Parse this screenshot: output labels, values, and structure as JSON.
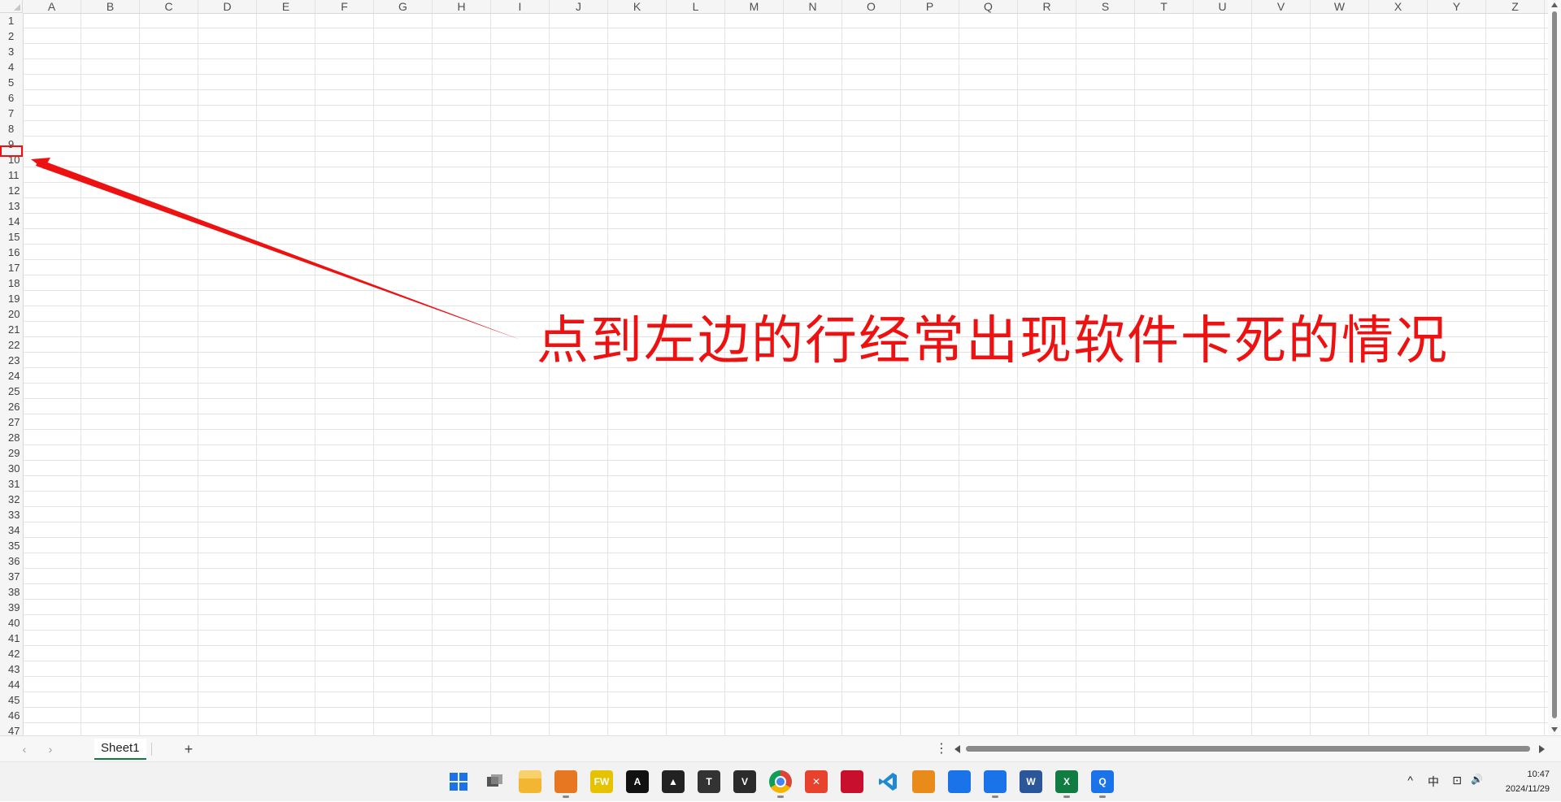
{
  "spreadsheet": {
    "columns": [
      "A",
      "B",
      "C",
      "D",
      "E",
      "F",
      "G",
      "H",
      "I",
      "J",
      "K",
      "L",
      "M",
      "N",
      "O",
      "P",
      "Q",
      "R",
      "S",
      "T",
      "U",
      "V",
      "W",
      "X",
      "Y",
      "Z"
    ],
    "rows": [
      "1",
      "2",
      "3",
      "4",
      "5",
      "6",
      "7",
      "8",
      "9",
      "10",
      "11",
      "12",
      "13",
      "14",
      "15",
      "16",
      "17",
      "18",
      "19",
      "20",
      "21",
      "22",
      "23",
      "24",
      "25",
      "26",
      "27",
      "28",
      "29",
      "30",
      "31",
      "32",
      "33",
      "34",
      "35",
      "36",
      "37",
      "38",
      "39",
      "40",
      "41",
      "42",
      "43",
      "44",
      "45",
      "46",
      "47"
    ],
    "highlighted_row": "10"
  },
  "annotation": {
    "text": "点到左边的行经常出现软件卡死的情况",
    "color": "#ee1111"
  },
  "sheet_bar": {
    "prev_label": "‹",
    "next_label": "›",
    "active_sheet": "Sheet1",
    "add_label": "+",
    "more_label": "⋮"
  },
  "taskbar": {
    "icons": [
      {
        "name": "windows-start-icon",
        "glyph": "",
        "color": "#1a73e8"
      },
      {
        "name": "task-view-icon",
        "glyph": "",
        "color": "#555555"
      },
      {
        "name": "file-explorer-icon",
        "glyph": "",
        "color": "#f2b632"
      },
      {
        "name": "search-app-icon",
        "glyph": "",
        "color": "#e87722"
      },
      {
        "name": "fw-app-icon",
        "glyph": "FW",
        "color": "#e6c200"
      },
      {
        "name": "ai-app-icon",
        "glyph": "A",
        "color": "#111111"
      },
      {
        "name": "triangle-app-icon",
        "glyph": "▲",
        "color": "#222222"
      },
      {
        "name": "typora-icon",
        "glyph": "T",
        "color": "#333333"
      },
      {
        "name": "v-app-icon",
        "glyph": "V",
        "color": "#2b2b2b"
      },
      {
        "name": "chrome-icon",
        "glyph": "",
        "color": "#db4437"
      },
      {
        "name": "x-app-icon",
        "glyph": "✕",
        "color": "#e8412c"
      },
      {
        "name": "pdf-icon",
        "glyph": "",
        "color": "#c8102e"
      },
      {
        "name": "vscode-icon",
        "glyph": "",
        "color": "#1f8ad2"
      },
      {
        "name": "window-app-icon",
        "glyph": "",
        "color": "#e88b1a"
      },
      {
        "name": "lark-icon",
        "glyph": "",
        "color": "#1a73e8"
      },
      {
        "name": "lark-2-icon",
        "glyph": "",
        "color": "#1a73e8"
      },
      {
        "name": "word-icon",
        "glyph": "W",
        "color": "#2b579a"
      },
      {
        "name": "excel-icon",
        "glyph": "X",
        "color": "#107c41"
      },
      {
        "name": "q-app-icon",
        "glyph": "Q",
        "color": "#1a73e8"
      }
    ],
    "tray": {
      "chevron": "^",
      "ime": "中",
      "network": "⊡",
      "volume": "🔊"
    },
    "clock": {
      "time": "10:47",
      "date": "2024/11/29"
    }
  }
}
